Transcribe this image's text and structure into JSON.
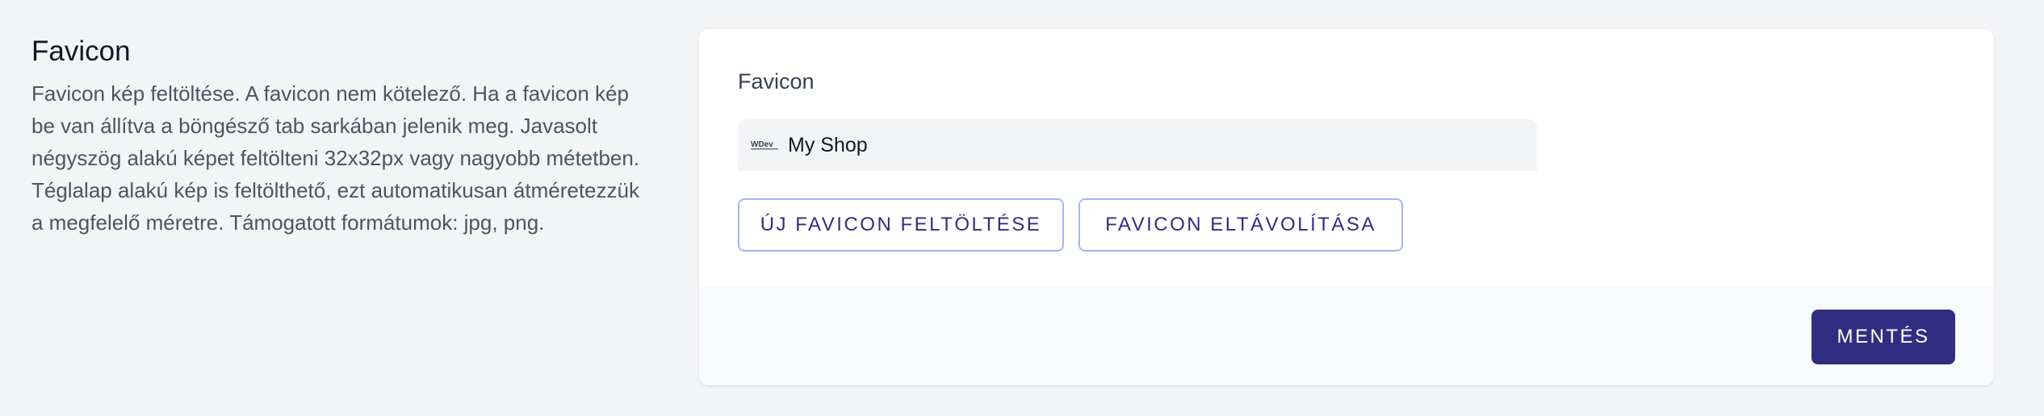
{
  "section": {
    "title": "Favicon",
    "description": "Favicon kép feltöltése. A favicon nem kötelező. Ha a favicon kép be van állítva a böngésző tab sarkában jelenik meg. Javasolt négyszög alakú képet feltölteni 32x32px vagy nagyobb métetben. Téglalap alakú kép is feltölthető, ezt automatikusan átméretezzük a megfelelő méretre. Támogatott formátumok: jpg, png."
  },
  "form": {
    "field_label": "Favicon",
    "preview": {
      "icon": "wdev-logo-icon",
      "icon_text": "WDev",
      "title": "My Shop"
    },
    "upload_button": "ÚJ FAVICON FELTÖLTÉSE",
    "remove_button": "FAVICON ELTÁVOLÍTÁSA"
  },
  "footer": {
    "save_button": "MENTÉS"
  },
  "colors": {
    "page_bg": "#f3f4f6",
    "card_bg": "#ffffff",
    "footer_bg": "#f9fafb",
    "primary": "#312e81",
    "outline_border": "#a5b4fc"
  }
}
